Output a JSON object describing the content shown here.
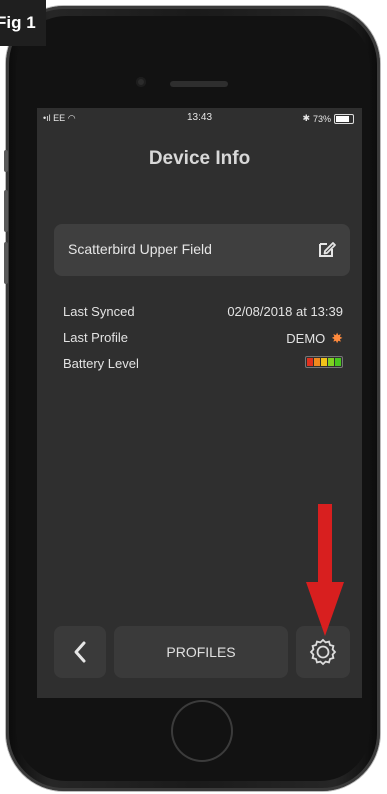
{
  "figure_label": "Fig 1",
  "status_bar": {
    "carrier": "EE",
    "time": "13:43",
    "battery_percent": "73%"
  },
  "page": {
    "title": "Device Info"
  },
  "device": {
    "name": "Scatterbird Upper Field"
  },
  "info": {
    "last_synced_label": "Last Synced",
    "last_synced_value": "02/08/2018 at 13:39",
    "last_profile_label": "Last Profile",
    "last_profile_value": "DEMO",
    "battery_label": "Battery Level",
    "battery_segments": [
      "#e0321e",
      "#f08a1d",
      "#f2c31a",
      "#7fd321",
      "#49c61f"
    ]
  },
  "nav": {
    "back_icon": "chevron-left-icon",
    "profiles_label": "PROFILES",
    "settings_icon": "gear-icon"
  },
  "annotation": {
    "arrow_color": "#d81f1f"
  }
}
